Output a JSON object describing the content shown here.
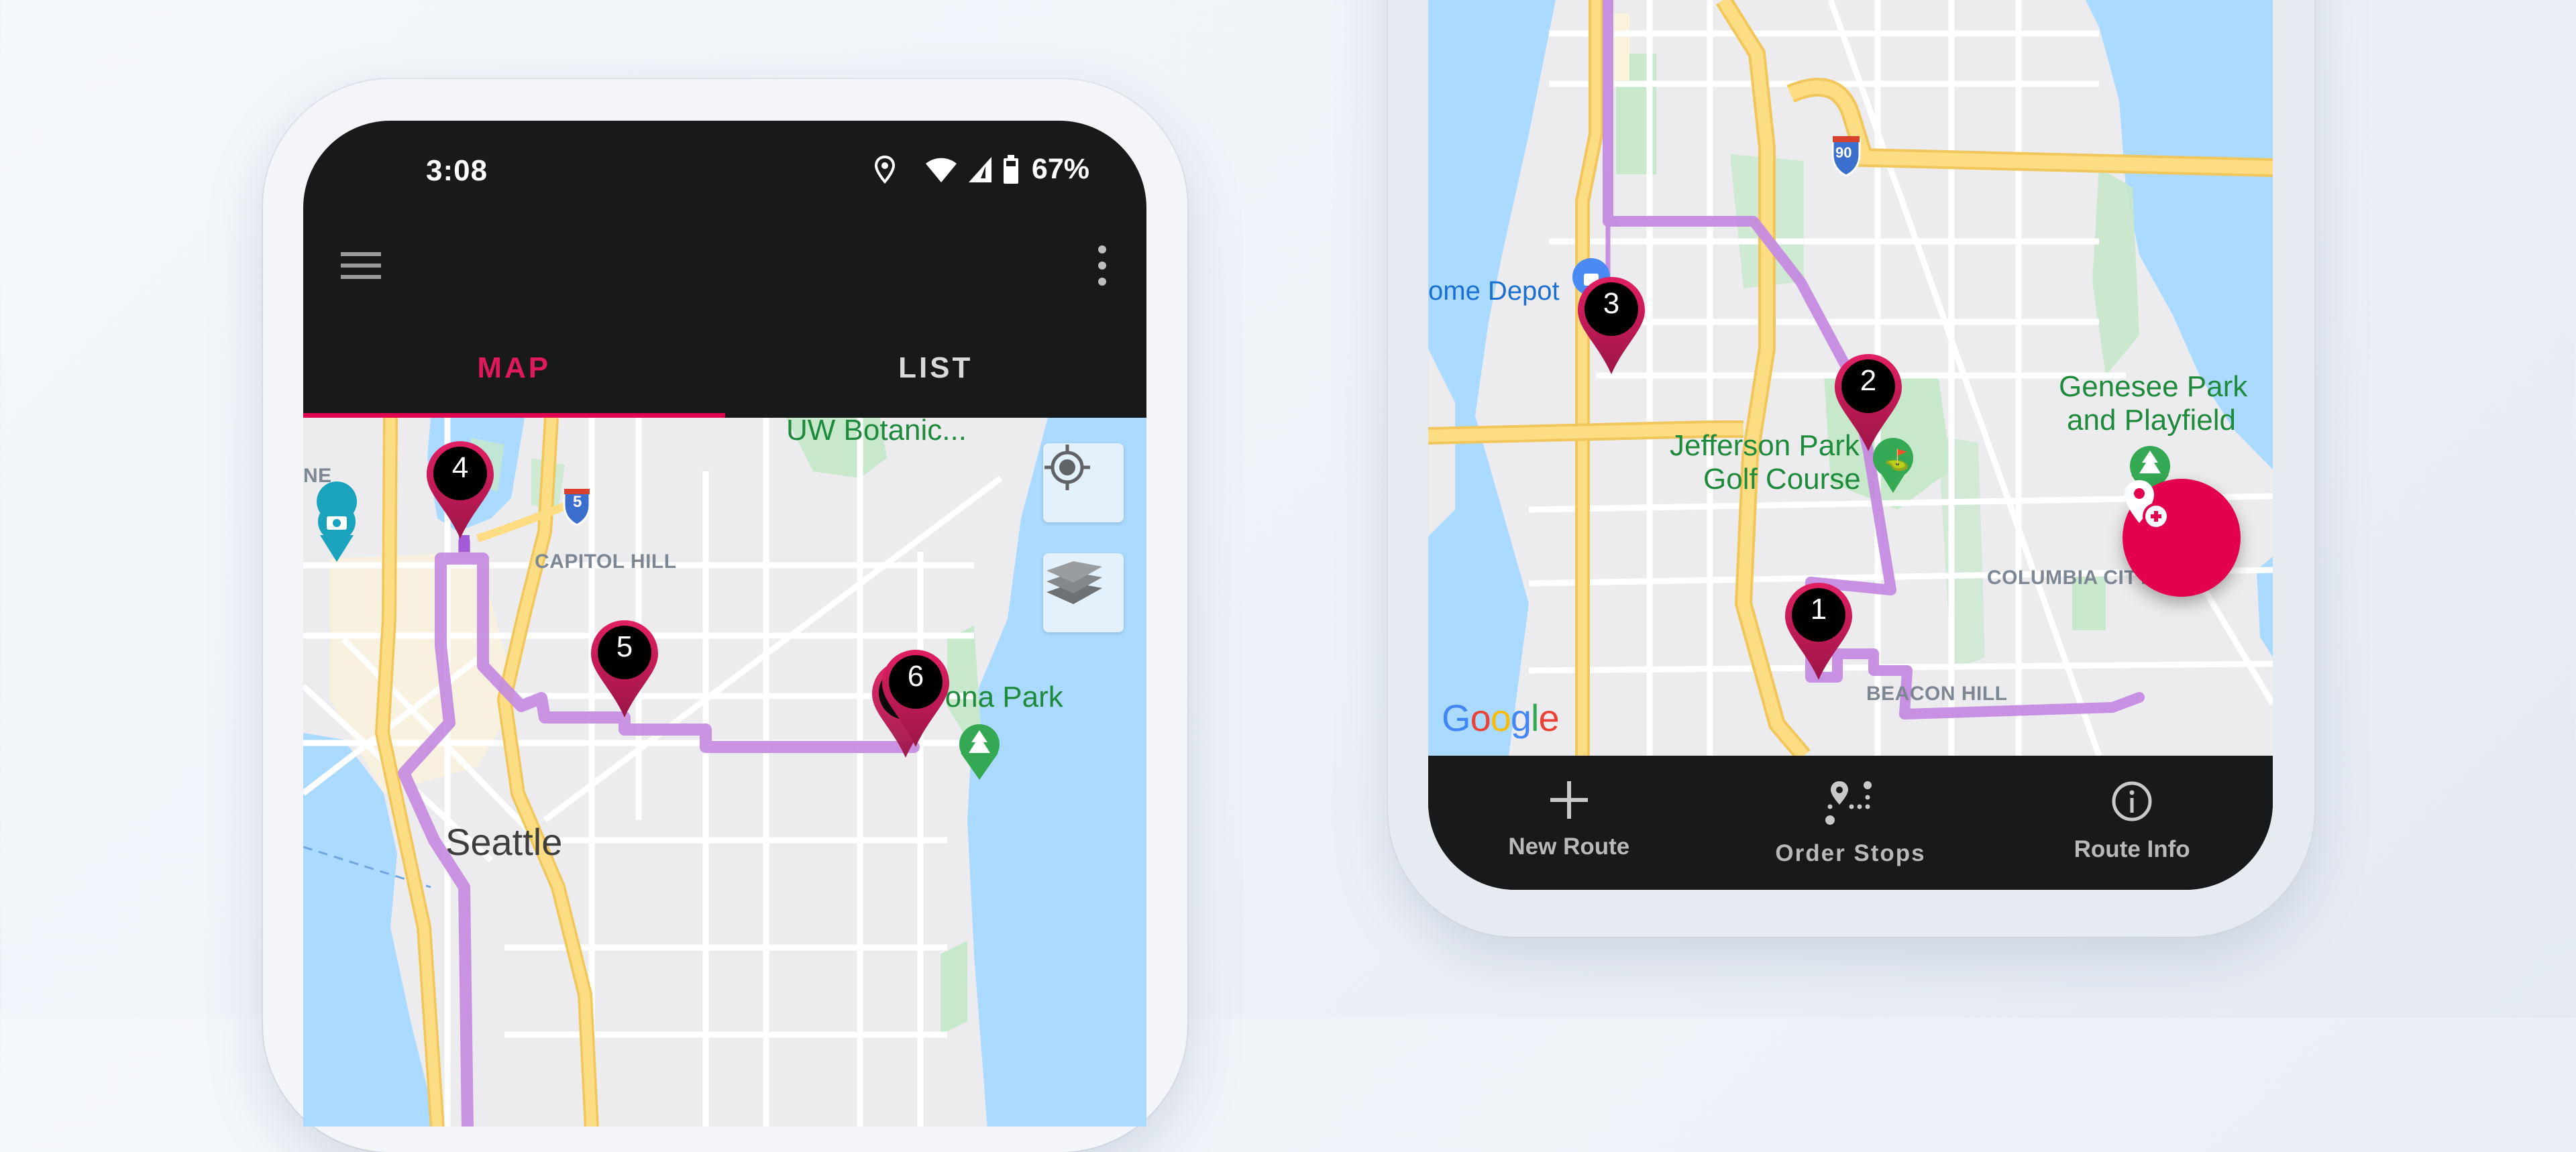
{
  "left_phone": {
    "status_bar": {
      "time": "3:08",
      "icons": [
        "location-icon",
        "wifi-icon",
        "cell-signal-icon",
        "battery-icon"
      ],
      "battery_percent": "67%"
    },
    "toolbar": {
      "menu_icon": "hamburger-menu-icon",
      "more_icon": "more-vert-icon"
    },
    "tabs": [
      {
        "label": "MAP",
        "active": true
      },
      {
        "label": "LIST",
        "active": false
      }
    ],
    "map": {
      "labels": {
        "uw_botanic": "UW Botanic...",
        "capitol_hill": "CAPITOL HILL",
        "seattle": "Seattle",
        "park": "rona Park",
        "partial_ne": "NE",
        "interstate": "5"
      },
      "stops": [
        {
          "number": "4"
        },
        {
          "number": "5"
        },
        {
          "number": "6"
        }
      ],
      "controls": [
        {
          "name": "my-location",
          "icon": "crosshair-icon"
        },
        {
          "name": "layers",
          "icon": "layers-icon"
        }
      ]
    }
  },
  "right_phone": {
    "map": {
      "labels": {
        "home_depot": "ome Depot",
        "jefferson_park": "Jefferson Park",
        "golf_course": "Golf Course",
        "genesee_park": "Genesee Park",
        "playfield": "and Playfield",
        "columbia_city": "COLUMBIA CITY",
        "beacon_hill": "BEACON HILL",
        "interstate": "90"
      },
      "stops": [
        {
          "number": "3"
        },
        {
          "number": "2"
        },
        {
          "number": "1"
        }
      ],
      "google_logo": [
        "G",
        "o",
        "o",
        "g",
        "l",
        "e"
      ]
    },
    "fab": {
      "icon": "add-location-icon"
    },
    "bottom_nav": [
      {
        "label": "New Route",
        "icon": "plus-icon"
      },
      {
        "label": "Order Stops",
        "icon": "order-stops-icon"
      },
      {
        "label": "Route Info",
        "icon": "info-icon"
      }
    ]
  },
  "colors": {
    "accent": "#e0004f",
    "pin_top": "#e21f64",
    "pin_bottom": "#9b1547",
    "route": "#c58be0",
    "app_bar": "#18191b",
    "water": "#aadaff",
    "park": "#c8e8cb",
    "highway": "#fddd84"
  }
}
